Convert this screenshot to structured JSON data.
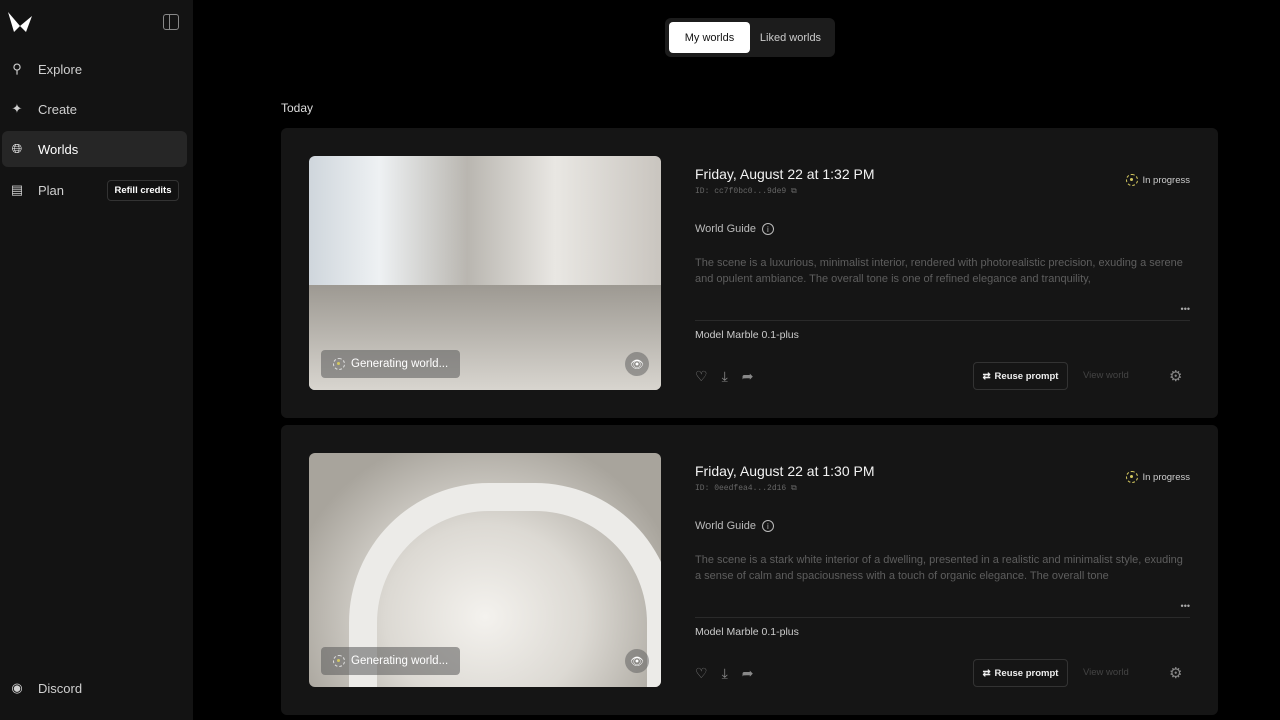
{
  "sidebar": {
    "nav": [
      {
        "label": "Explore",
        "icon": "search-icon"
      },
      {
        "label": "Create",
        "icon": "sparkle-icon"
      },
      {
        "label": "Worlds",
        "icon": "globe-icon",
        "active": true
      },
      {
        "label": "Plan",
        "icon": "clipboard-icon"
      }
    ],
    "refill_label": "Refill credits",
    "discord_label": "Discord"
  },
  "tabs": {
    "my": "My worlds",
    "liked": "Liked worlds"
  },
  "section": "Today",
  "worlds": [
    {
      "date": "Friday, August 22 at 1:32 PM",
      "id": "ID: cc7f0bc0...9de9",
      "status": "In progress",
      "guide_label": "World Guide",
      "description": "The scene is a luxurious, minimalist interior, rendered with photorealistic precision, exuding a serene and opulent ambiance. The overall tone is one of refined elegance and tranquility,",
      "model": "Model Marble 0.1-plus",
      "generating": "Generating world...",
      "reuse": "Reuse prompt",
      "view": "View world",
      "more": "•••"
    },
    {
      "date": "Friday, August 22 at 1:30 PM",
      "id": "ID: 0eedfea4...2d16",
      "status": "In progress",
      "guide_label": "World Guide",
      "description": "The scene is a stark white interior of a dwelling, presented in a realistic and minimalist style, exuding a sense of calm and spaciousness with a touch of organic elegance. The overall tone",
      "model": "Model Marble 0.1-plus",
      "generating": "Generating world...",
      "reuse": "Reuse prompt",
      "view": "View world",
      "more": "•••"
    }
  ]
}
